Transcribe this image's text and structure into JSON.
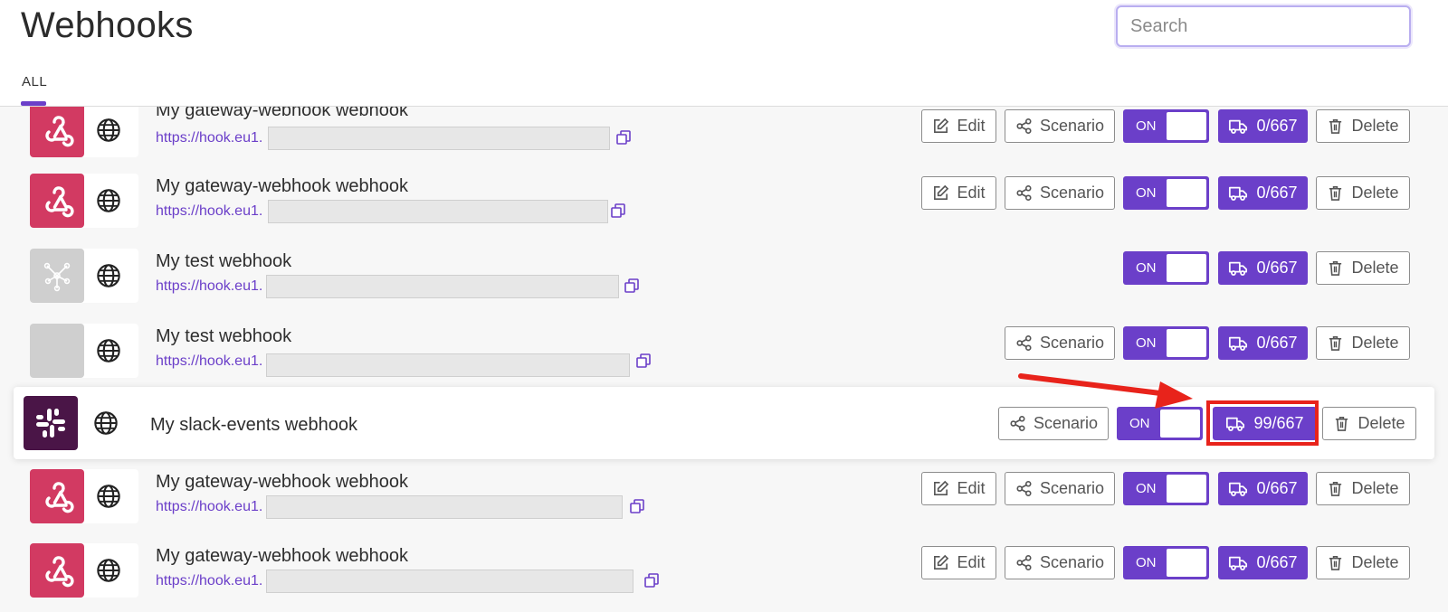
{
  "header": {
    "title": "Webhooks",
    "search_placeholder": "Search",
    "tab_all": "ALL"
  },
  "labels": {
    "edit": "Edit",
    "scenario": "Scenario",
    "on": "ON",
    "delete": "Delete"
  },
  "colors": {
    "accent": "#6b3fc9",
    "gateway_icon": "#d23a62",
    "slack_icon": "#4a1547",
    "annotation": "#e8231b"
  },
  "webhooks": [
    {
      "name": "My gateway-webhook webhook",
      "url_prefix": "https://hook.eu1.",
      "ops": "0/667",
      "icon": "webhook-icon"
    },
    {
      "name": "My gateway-webhook webhook",
      "url_prefix": "https://hook.eu1.",
      "ops": "0/667",
      "icon": "webhook-icon"
    },
    {
      "name": "My test webhook",
      "url_prefix": "https://hook.eu1.",
      "ops": "0/667",
      "icon": "network-icon"
    },
    {
      "name": "My test webhook",
      "url_prefix": "https://hook.eu1.",
      "ops": "0/667",
      "icon": "blank-icon"
    },
    {
      "name": "My slack-events webhook",
      "ops": "99/667",
      "icon": "slack-icon"
    },
    {
      "name": "My gateway-webhook webhook",
      "url_prefix": "https://hook.eu1.",
      "ops": "0/667",
      "icon": "webhook-icon"
    },
    {
      "name": "My gateway-webhook webhook",
      "url_prefix": "https://hook.eu1.",
      "ops": "0/667",
      "icon": "webhook-icon"
    }
  ]
}
